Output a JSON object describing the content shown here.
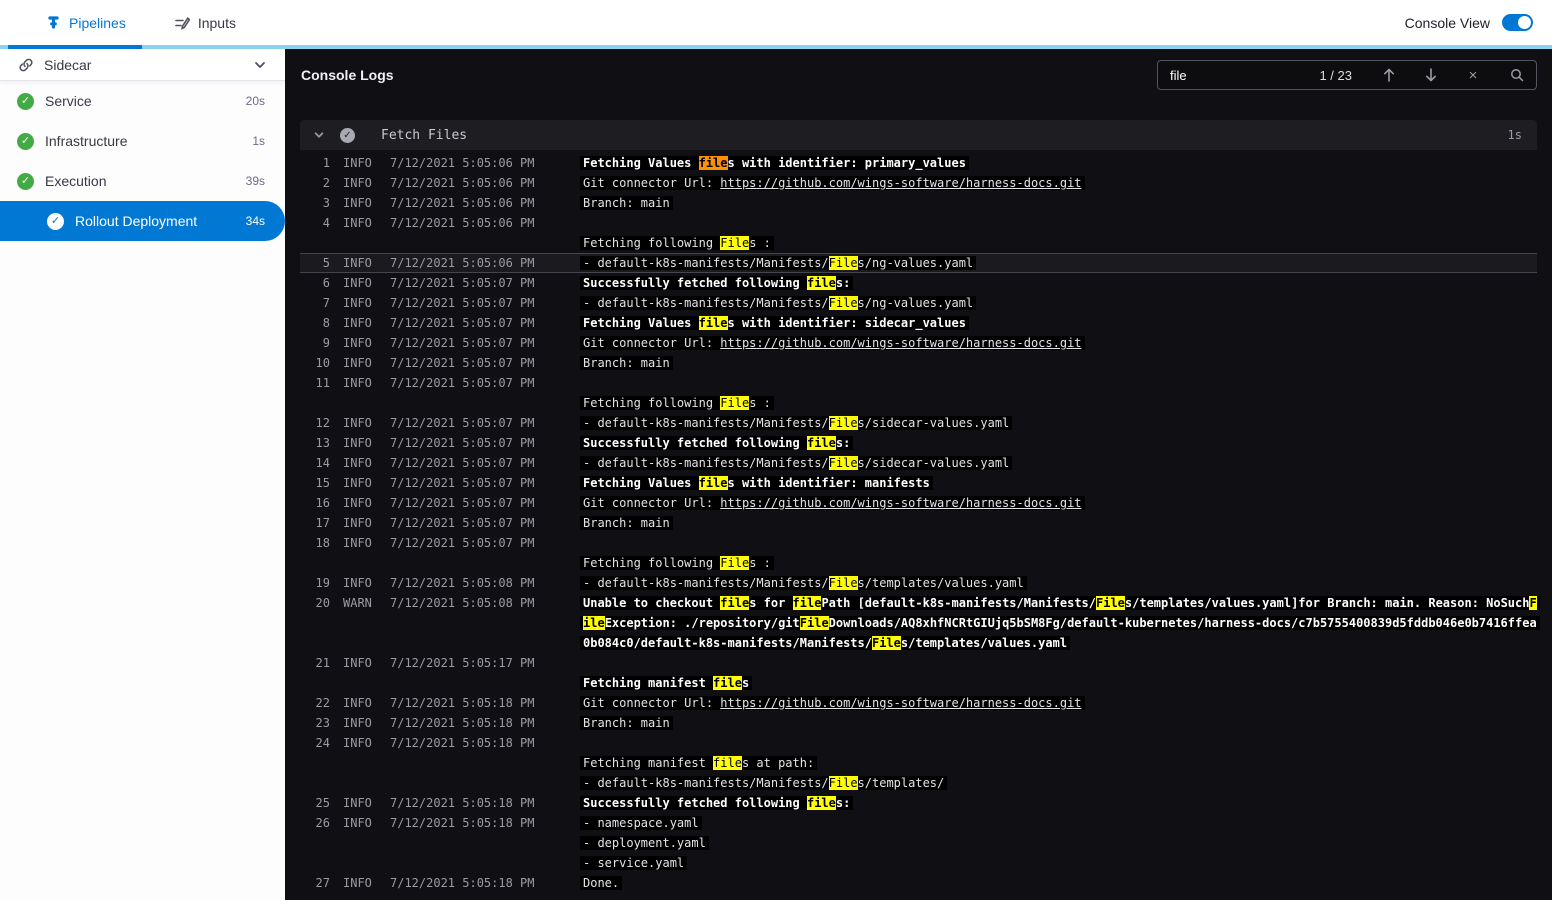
{
  "top_bar": {
    "tabs": [
      {
        "label": "Pipelines",
        "icon": "pipeline-icon",
        "active": true
      },
      {
        "label": "Inputs",
        "icon": "inputs-icon",
        "active": false
      }
    ],
    "console_view_label": "Console View",
    "console_view_on": true
  },
  "sidebar": {
    "title": "Sidecar",
    "items": [
      {
        "label": "Service",
        "duration": "20s",
        "status": "success",
        "selected": false
      },
      {
        "label": "Infrastructure",
        "duration": "1s",
        "status": "success",
        "selected": false
      },
      {
        "label": "Execution",
        "duration": "39s",
        "status": "success",
        "selected": false
      },
      {
        "label": "Rollout Deployment",
        "duration": "34s",
        "status": "success",
        "selected": true
      }
    ]
  },
  "console": {
    "title": "Console Logs",
    "search": {
      "value": "file",
      "counter": "1 / 23",
      "icons": [
        "arrow-up",
        "arrow-down",
        "close",
        "search"
      ]
    },
    "section": {
      "title": "Fetch Files",
      "duration": "1s"
    },
    "colors": {
      "match": "#ffff00",
      "current_match": "#ff9102",
      "selected_step": "#0278d5",
      "success": "#42ab45"
    },
    "logs": [
      {
        "n": "1",
        "lv": "INFO",
        "t": "7/12/2021 5:05:06 PM",
        "lines": [
          [
            {
              "t": "Fetching Values ",
              "b": 1
            },
            {
              "t": "file",
              "b": 1,
              "h": "o"
            },
            {
              "t": "s with identifier: primary_values",
              "b": 1
            }
          ]
        ]
      },
      {
        "n": "2",
        "lv": "INFO",
        "t": "7/12/2021 5:05:06 PM",
        "lines": [
          [
            {
              "t": "Git connector Url: "
            },
            {
              "t": "https://github.com/wings-software/harness-docs.git",
              "l": 1
            }
          ]
        ]
      },
      {
        "n": "3",
        "lv": "INFO",
        "t": "7/12/2021 5:05:06 PM",
        "lines": [
          [
            {
              "t": "Branch: main"
            }
          ]
        ]
      },
      {
        "n": "4",
        "lv": "INFO",
        "t": "7/12/2021 5:05:06 PM",
        "lines": [
          [],
          [
            {
              "t": "Fetching following "
            },
            {
              "t": "File",
              "h": "y"
            },
            {
              "t": "s :"
            }
          ]
        ]
      },
      {
        "n": "5",
        "lv": "INFO",
        "t": "7/12/2021 5:05:06 PM",
        "sel": 1,
        "lines": [
          [
            {
              "t": "- default-k8s-manifests/Manifests/"
            },
            {
              "t": "File",
              "h": "y"
            },
            {
              "t": "s/ng-values.yaml"
            }
          ]
        ]
      },
      {
        "n": "6",
        "lv": "INFO",
        "t": "7/12/2021 5:05:07 PM",
        "lines": [
          [
            {
              "t": "Successfully fetched following ",
              "b": 1
            },
            {
              "t": "file",
              "b": 1,
              "h": "y"
            },
            {
              "t": "s:",
              "b": 1
            }
          ]
        ]
      },
      {
        "n": "7",
        "lv": "INFO",
        "t": "7/12/2021 5:05:07 PM",
        "lines": [
          [
            {
              "t": "- default-k8s-manifests/Manifests/"
            },
            {
              "t": "File",
              "h": "y"
            },
            {
              "t": "s/ng-values.yaml"
            }
          ]
        ]
      },
      {
        "n": "8",
        "lv": "INFO",
        "t": "7/12/2021 5:05:07 PM",
        "lines": [
          [
            {
              "t": "Fetching Values ",
              "b": 1
            },
            {
              "t": "file",
              "b": 1,
              "h": "y"
            },
            {
              "t": "s with identifier: sidecar_values",
              "b": 1
            }
          ]
        ]
      },
      {
        "n": "9",
        "lv": "INFO",
        "t": "7/12/2021 5:05:07 PM",
        "lines": [
          [
            {
              "t": "Git connector Url: "
            },
            {
              "t": "https://github.com/wings-software/harness-docs.git",
              "l": 1
            }
          ]
        ]
      },
      {
        "n": "10",
        "lv": "INFO",
        "t": "7/12/2021 5:05:07 PM",
        "lines": [
          [
            {
              "t": "Branch: main"
            }
          ]
        ]
      },
      {
        "n": "11",
        "lv": "INFO",
        "t": "7/12/2021 5:05:07 PM",
        "lines": [
          [],
          [
            {
              "t": "Fetching following "
            },
            {
              "t": "File",
              "h": "y"
            },
            {
              "t": "s :"
            }
          ]
        ]
      },
      {
        "n": "12",
        "lv": "INFO",
        "t": "7/12/2021 5:05:07 PM",
        "lines": [
          [
            {
              "t": "- default-k8s-manifests/Manifests/"
            },
            {
              "t": "File",
              "h": "y"
            },
            {
              "t": "s/sidecar-values.yaml"
            }
          ]
        ]
      },
      {
        "n": "13",
        "lv": "INFO",
        "t": "7/12/2021 5:05:07 PM",
        "lines": [
          [
            {
              "t": "Successfully fetched following ",
              "b": 1
            },
            {
              "t": "file",
              "b": 1,
              "h": "y"
            },
            {
              "t": "s:",
              "b": 1
            }
          ]
        ]
      },
      {
        "n": "14",
        "lv": "INFO",
        "t": "7/12/2021 5:05:07 PM",
        "lines": [
          [
            {
              "t": "- default-k8s-manifests/Manifests/"
            },
            {
              "t": "File",
              "h": "y"
            },
            {
              "t": "s/sidecar-values.yaml"
            }
          ]
        ]
      },
      {
        "n": "15",
        "lv": "INFO",
        "t": "7/12/2021 5:05:07 PM",
        "lines": [
          [
            {
              "t": "Fetching Values ",
              "b": 1
            },
            {
              "t": "file",
              "b": 1,
              "h": "y"
            },
            {
              "t": "s with identifier: manifests",
              "b": 1
            }
          ]
        ]
      },
      {
        "n": "16",
        "lv": "INFO",
        "t": "7/12/2021 5:05:07 PM",
        "lines": [
          [
            {
              "t": "Git connector Url: "
            },
            {
              "t": "https://github.com/wings-software/harness-docs.git",
              "l": 1
            }
          ]
        ]
      },
      {
        "n": "17",
        "lv": "INFO",
        "t": "7/12/2021 5:05:07 PM",
        "lines": [
          [
            {
              "t": "Branch: main"
            }
          ]
        ]
      },
      {
        "n": "18",
        "lv": "INFO",
        "t": "7/12/2021 5:05:07 PM",
        "lines": [
          [],
          [
            {
              "t": "Fetching following "
            },
            {
              "t": "File",
              "h": "y"
            },
            {
              "t": "s :"
            }
          ]
        ]
      },
      {
        "n": "19",
        "lv": "INFO",
        "t": "7/12/2021 5:05:08 PM",
        "lines": [
          [
            {
              "t": "- default-k8s-manifests/Manifests/"
            },
            {
              "t": "File",
              "h": "y"
            },
            {
              "t": "s/templates/values.yaml"
            }
          ]
        ]
      },
      {
        "n": "20",
        "lv": "WARN",
        "t": "7/12/2021 5:05:08 PM",
        "lines": [
          [
            {
              "t": "Unable to checkout ",
              "b": 1
            },
            {
              "t": "file",
              "b": 1,
              "h": "y"
            },
            {
              "t": "s for ",
              "b": 1
            },
            {
              "t": "file",
              "b": 1,
              "h": "y"
            },
            {
              "t": "Path [default-k8s-manifests/Manifests/",
              "b": 1
            },
            {
              "t": "File",
              "b": 1,
              "h": "y"
            },
            {
              "t": "s/templates/values.yaml]for Branch: main. Reason: NoSuch",
              "b": 1
            },
            {
              "t": "F",
              "b": 1,
              "h": "y"
            }
          ],
          [
            {
              "t": "ile",
              "b": 1,
              "h": "y"
            },
            {
              "t": "Exception: ./repository/git",
              "b": 1
            },
            {
              "t": "File",
              "b": 1,
              "h": "y"
            },
            {
              "t": "Downloads/AQ8xhfNCRtGIUjq5bSM8Fg/default-kubernetes/harness-docs/c7b5755400839d5fddb046e0b7416ffea",
              "b": 1
            }
          ],
          [
            {
              "t": "0b084c0/default-k8s-manifests/Manifests/",
              "b": 1
            },
            {
              "t": "File",
              "b": 1,
              "h": "y"
            },
            {
              "t": "s/templates/values.yaml",
              "b": 1
            }
          ]
        ]
      },
      {
        "n": "21",
        "lv": "INFO",
        "t": "7/12/2021 5:05:17 PM",
        "lines": [
          [],
          [
            {
              "t": "Fetching manifest ",
              "b": 1
            },
            {
              "t": "file",
              "b": 1,
              "h": "y"
            },
            {
              "t": "s",
              "b": 1
            }
          ]
        ]
      },
      {
        "n": "22",
        "lv": "INFO",
        "t": "7/12/2021 5:05:18 PM",
        "lines": [
          [
            {
              "t": "Git connector Url: "
            },
            {
              "t": "https://github.com/wings-software/harness-docs.git",
              "l": 1
            }
          ]
        ]
      },
      {
        "n": "23",
        "lv": "INFO",
        "t": "7/12/2021 5:05:18 PM",
        "lines": [
          [
            {
              "t": "Branch: main"
            }
          ]
        ]
      },
      {
        "n": "24",
        "lv": "INFO",
        "t": "7/12/2021 5:05:18 PM",
        "lines": [
          [],
          [
            {
              "t": "Fetching manifest "
            },
            {
              "t": "file",
              "h": "y"
            },
            {
              "t": "s at path:"
            }
          ],
          [
            {
              "t": "- default-k8s-manifests/Manifests/"
            },
            {
              "t": "File",
              "h": "y"
            },
            {
              "t": "s/templates/"
            }
          ]
        ]
      },
      {
        "n": "25",
        "lv": "INFO",
        "t": "7/12/2021 5:05:18 PM",
        "lines": [
          [
            {
              "t": "Successfully fetched following ",
              "b": 1
            },
            {
              "t": "file",
              "b": 1,
              "h": "y"
            },
            {
              "t": "s:",
              "b": 1
            }
          ]
        ]
      },
      {
        "n": "26",
        "lv": "INFO",
        "t": "7/12/2021 5:05:18 PM",
        "lines": [
          [
            {
              "t": "- namespace.yaml"
            }
          ],
          [
            {
              "t": "- deployment.yaml"
            }
          ],
          [
            {
              "t": "- service.yaml"
            }
          ]
        ]
      },
      {
        "n": "27",
        "lv": "INFO",
        "t": "7/12/2021 5:05:18 PM",
        "lines": [
          [
            {
              "t": "Done."
            }
          ]
        ]
      }
    ]
  }
}
